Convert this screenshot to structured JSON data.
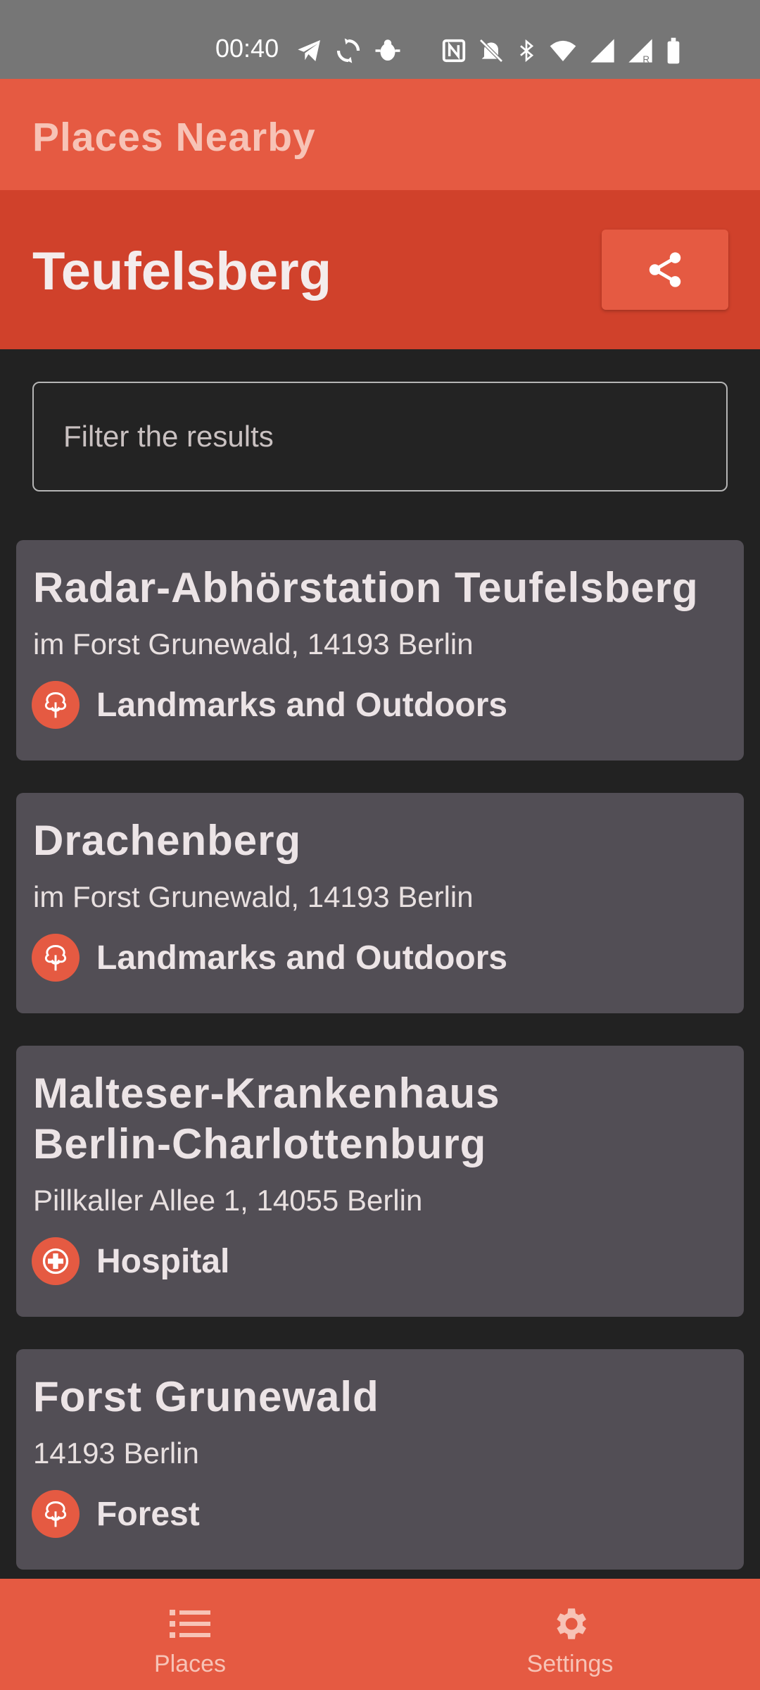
{
  "status_bar": {
    "time": "00:40",
    "icons": [
      "telegram-icon",
      "sync-icon",
      "bug-icon",
      "nfc-icon",
      "mute-icon",
      "bluetooth-icon",
      "wifi-icon",
      "signal-icon",
      "signal-roaming-icon",
      "battery-icon"
    ]
  },
  "app_bar": {
    "title": "Places Nearby"
  },
  "location": {
    "title": "Teufelsberg",
    "share_icon": "share-icon"
  },
  "filter": {
    "placeholder": "Filter the results"
  },
  "places": [
    {
      "name": "Radar-Abhörstation Teufelsberg",
      "address": "im Forst Grunewald, 14193 Berlin",
      "category": "Landmarks and Outdoors",
      "icon": "tree-icon"
    },
    {
      "name": "Drachenberg",
      "address": "im Forst Grunewald, 14193 Berlin",
      "category": "Landmarks and Outdoors",
      "icon": "tree-icon"
    },
    {
      "name_line1": "Malteser-Krankenhaus",
      "name_line2": "Berlin-Charlottenburg",
      "address": "Pillkaller Allee 1, 14055 Berlin",
      "category": "Hospital",
      "icon": "hospital-cross-icon"
    },
    {
      "name": "Forst Grunewald",
      "address": "14193 Berlin",
      "category": "Forest",
      "icon": "tree-icon"
    }
  ],
  "bottom_nav": {
    "places_label": "Places",
    "settings_label": "Settings"
  },
  "colors": {
    "primary": "#e55a42",
    "primary_dark": "#d0412b",
    "card": "#524e55",
    "background": "#222222"
  }
}
